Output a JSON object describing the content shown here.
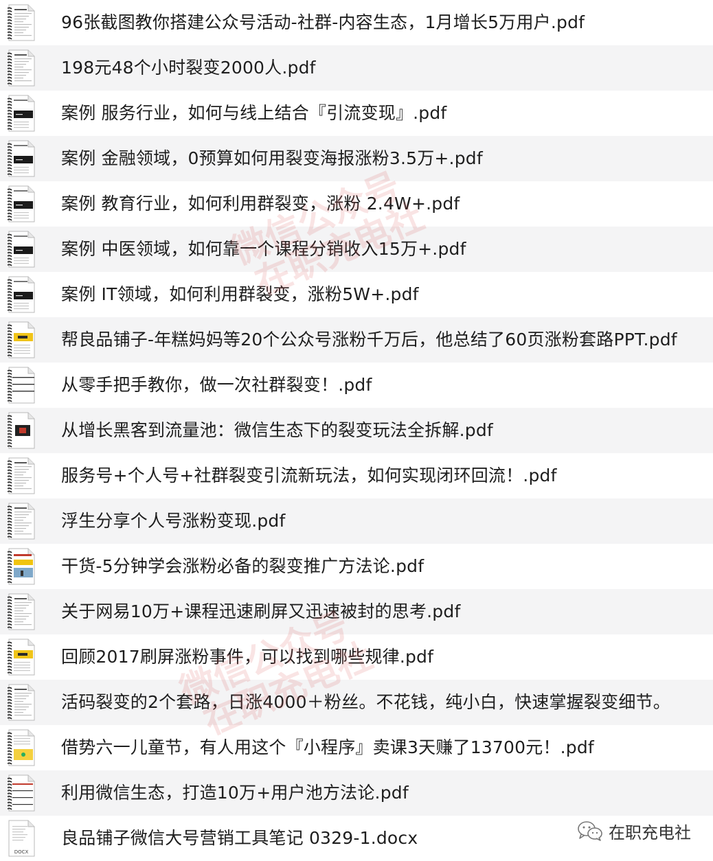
{
  "files": [
    {
      "name": "96张截图教你搭建公众号活动-社群-内容生态，1月增长5万用户.pdf",
      "type": "pdf",
      "thumb": "text"
    },
    {
      "name": "198元48个小时裂变2000人.pdf",
      "type": "pdf",
      "thumb": "text"
    },
    {
      "name": "案例  服务行业，如何与线上结合『引流变现』.pdf",
      "type": "pdf",
      "thumb": "dark-banner"
    },
    {
      "name": "案例  金融领域，0预算如何用裂变海报涨粉3.5万+.pdf",
      "type": "pdf",
      "thumb": "dark-banner"
    },
    {
      "name": "案例 教育行业，如何利用群裂变，涨粉 2.4W+.pdf",
      "type": "pdf",
      "thumb": "dark-banner"
    },
    {
      "name": "案例 中医领域，如何靠一个课程分销收入15万+.pdf",
      "type": "pdf",
      "thumb": "dark-banner"
    },
    {
      "name": "案例 IT领域，如何利用群裂变，涨粉5W+.pdf",
      "type": "pdf",
      "thumb": "dark-banner"
    },
    {
      "name": "帮良品铺子-年糕妈妈等20个公众号涨粉千万后，他总结了60页涨粉套路PPT.pdf",
      "type": "pdf",
      "thumb": "yellow"
    },
    {
      "name": "从零手把手教你，做一次社群裂变！.pdf",
      "type": "pdf",
      "thumb": "lines"
    },
    {
      "name": "从增长黑客到流量池：微信生态下的裂变玩法全拆解.pdf",
      "type": "pdf",
      "thumb": "red-block"
    },
    {
      "name": "服务号+个人号+社群裂变引流新玩法，如何实现闭环回流！.pdf",
      "type": "pdf",
      "thumb": "text"
    },
    {
      "name": "浮生分享个人号涨粉变现.pdf",
      "type": "pdf",
      "thumb": "text"
    },
    {
      "name": "干货-5分钟学会涨粉必备的裂变推广方法论.pdf",
      "type": "pdf",
      "thumb": "photo"
    },
    {
      "name": "关于网易10万+课程迅速刷屏又迅速被封的思考.pdf",
      "type": "pdf",
      "thumb": "text"
    },
    {
      "name": "回顾2017刷屏涨粉事件，可以找到哪些规律.pdf",
      "type": "pdf",
      "thumb": "yellow"
    },
    {
      "name": "活码裂变的2个套路，日涨4000＋粉丝。不花钱，纯小白，快速掌握裂变细节。",
      "type": "pdf",
      "thumb": "text"
    },
    {
      "name": "借势六一儿童节，有人用这个『小程序』卖课3天赚了13700元！.pdf",
      "type": "pdf",
      "thumb": "map"
    },
    {
      "name": "利用微信生态，打造10万+用户池方法论.pdf",
      "type": "pdf",
      "thumb": "red-line"
    },
    {
      "name": "良品铺子微信大号营销工具笔记 0329-1.docx",
      "type": "docx",
      "thumb": "docx",
      "ext_label": "DOCX"
    }
  ],
  "watermarks": [
    {
      "line1": "微信公众号",
      "line2": "在职充电社"
    },
    {
      "line1": "微信公众号",
      "line2": "在职充电社"
    }
  ],
  "brand": {
    "icon": "wechat-icon",
    "text": "在职充电社"
  },
  "colors": {
    "row_alt": "#f4f4f5",
    "text": "#1e1e1e",
    "watermark": "#d75a5a",
    "icon_spiral": "#2b2b2b"
  }
}
